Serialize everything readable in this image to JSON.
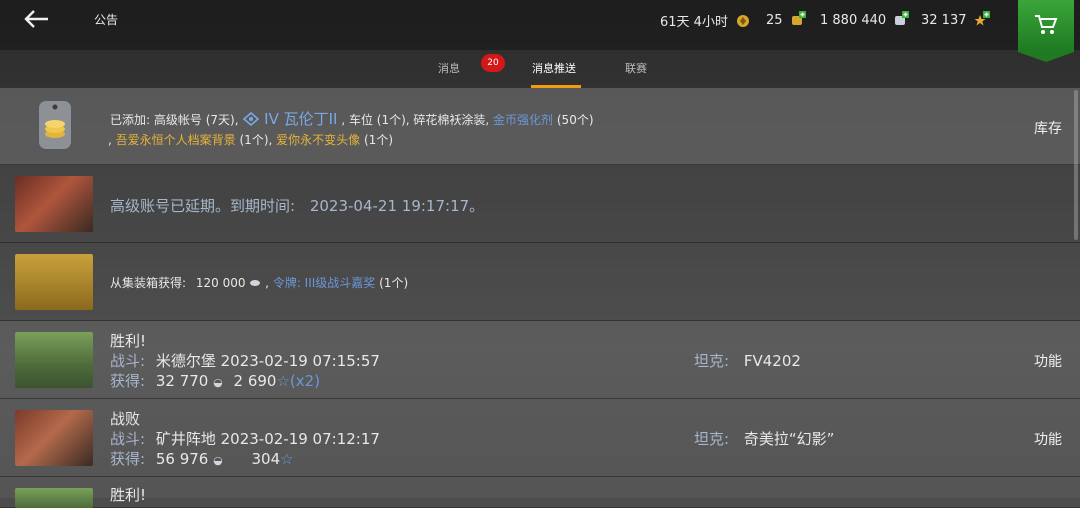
{
  "header": {
    "title": "公告",
    "premium_time": "61天 4小时",
    "item_count": "25",
    "silver": "1 880 440",
    "gold": "32 137"
  },
  "tabs": [
    {
      "label": "消息",
      "badge": "20"
    },
    {
      "label": "消息推送",
      "active": true
    },
    {
      "label": "联赛"
    }
  ],
  "notifications": [
    {
      "line1_prefix": "已添加:",
      "line1_items": "高级帐号 (7天),",
      "tank": "IV 瓦伦丁II",
      "line1_rest": ", 车位 (1个), 碎花棉袄涂装,",
      "booster": "金币强化剂",
      "booster_qty": "(50个)",
      "line2_gold1": "吾爱永恒个人档案背景",
      "line2_qty1": "(1个),",
      "line2_gold2": "爱你永不变头像",
      "line2_qty2": "(1个)",
      "action": "库存"
    },
    {
      "text": "高级账号已延期。到期时间:",
      "date": "2023-04-21 19:17:17。"
    },
    {
      "prefix": "从集装箱获得:",
      "silver": "120 000",
      "token": "令牌: III级战斗嘉奖",
      "token_qty": "(1个)"
    },
    {
      "result": "胜利!",
      "battle_label": "战斗:",
      "battle": "米德尔堡 2023-02-19 07:15:57",
      "earn_label": "获得:",
      "earn_silver": "32 770",
      "earn_xp": "2 690",
      "multiplier": "(x2)",
      "tank_label": "坦克:",
      "tank": "FV4202",
      "action": "功能"
    },
    {
      "result": "战败",
      "battle_label": "战斗:",
      "battle": "矿井阵地 2023-02-19 07:12:17",
      "earn_label": "获得:",
      "earn_silver": "56 976",
      "earn_xp": "304",
      "tank_label": "坦克:",
      "tank": "奇美拉“幻影”",
      "action": "功能"
    },
    {
      "result": "胜利!"
    }
  ]
}
